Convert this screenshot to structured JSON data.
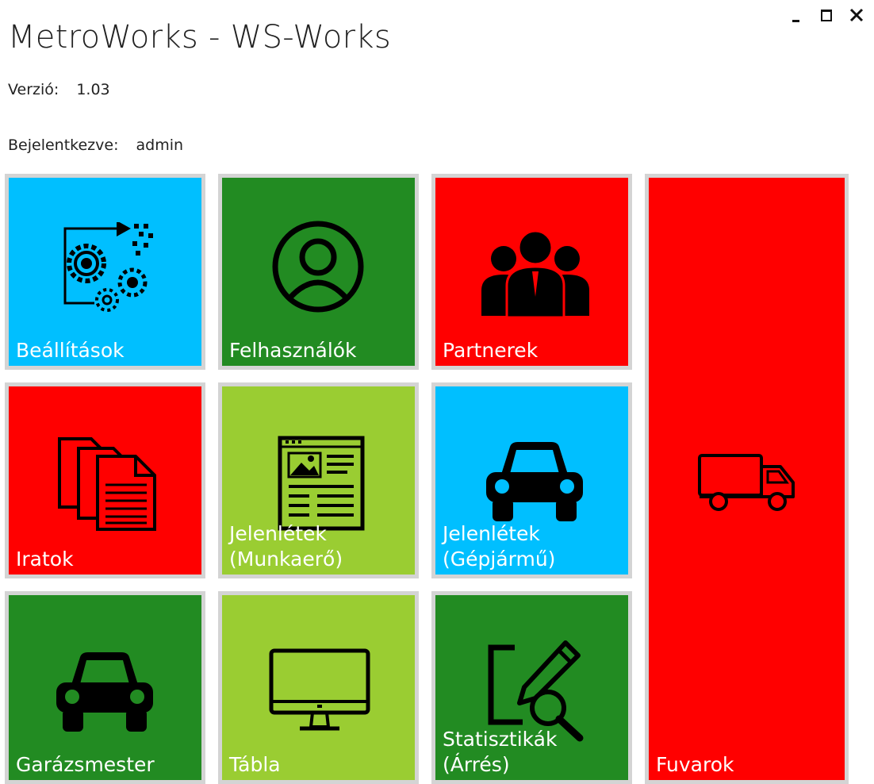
{
  "window": {
    "title": "MetroWorks - WS-Works",
    "version_label": "Verzió:",
    "version_value": "1.03",
    "login_label": "Bejelentkezve:",
    "login_user": "admin"
  },
  "tiles": [
    {
      "label": "Beállítások",
      "color": "#00bfff",
      "icon": "gears-icon"
    },
    {
      "label": "Felhasználók",
      "color": "#228b22",
      "icon": "user-circle-icon"
    },
    {
      "label": "Partnerek",
      "color": "#ff0000",
      "icon": "people-group-icon"
    },
    {
      "label": "Fuvarok",
      "color": "#ff0000",
      "icon": "truck-icon"
    },
    {
      "label": "Iratok",
      "color": "#ff0000",
      "icon": "documents-icon"
    },
    {
      "label": "Jelenlétek\n(Munkaerő)",
      "color": "#9acd32",
      "icon": "newspaper-icon"
    },
    {
      "label": "Jelenlétek\n(Gépjármű)",
      "color": "#00bfff",
      "icon": "car-icon"
    },
    {
      "label": "Garázsmester",
      "color": "#228b22",
      "icon": "car-icon"
    },
    {
      "label": "Tábla",
      "color": "#9acd32",
      "icon": "monitor-icon"
    },
    {
      "label": "Statisztikák\n(Árrés)",
      "color": "#228b22",
      "icon": "edit-search-icon"
    }
  ]
}
